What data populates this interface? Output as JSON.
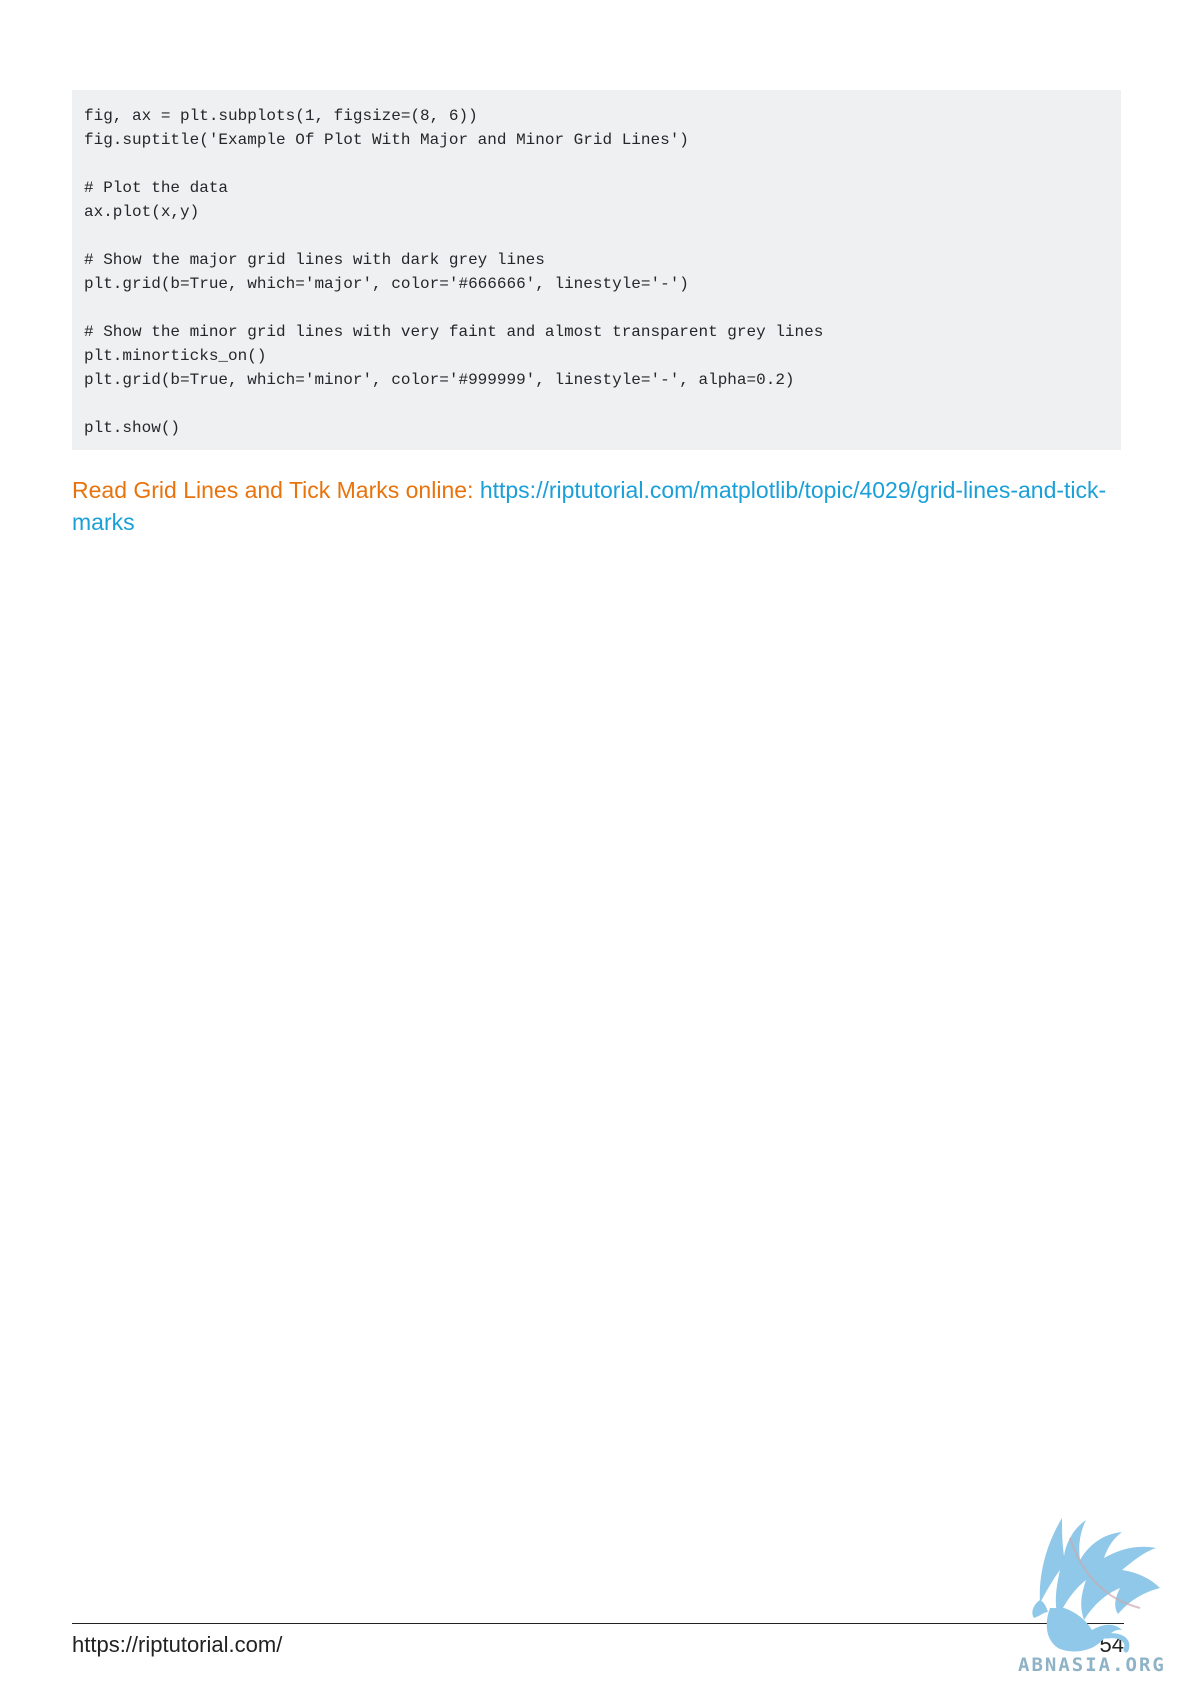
{
  "code": {
    "lines": [
      "fig, ax = plt.subplots(1, figsize=(8, 6))",
      "fig.suptitle('Example Of Plot With Major and Minor Grid Lines')",
      "",
      "# Plot the data",
      "ax.plot(x,y)",
      "",
      "# Show the major grid lines with dark grey lines",
      "plt.grid(b=True, which='major', color='#666666', linestyle='-')",
      "",
      "# Show the minor grid lines with very faint and almost transparent grey lines",
      "plt.minorticks_on()",
      "plt.grid(b=True, which='minor', color='#999999', linestyle='-', alpha=0.2)",
      "",
      "plt.show()"
    ]
  },
  "read_online": {
    "lead": "Read Grid Lines and Tick Marks online:",
    "link_text": "https://riptutorial.com/matplotlib/topic/4029/grid-lines-and-tick-marks",
    "link_href": "https://riptutorial.com/matplotlib/topic/4029/grid-lines-and-tick-marks"
  },
  "footer": {
    "url": "https://riptutorial.com/",
    "page_number": "54"
  },
  "watermark": {
    "text": "ABNASIA.ORG",
    "icon": "griffin-logo-icon"
  },
  "colors": {
    "lead": "#e8730c",
    "link": "#1a9fd8",
    "code_bg": "#eff0f1",
    "watermark": "#8fc8e8"
  }
}
